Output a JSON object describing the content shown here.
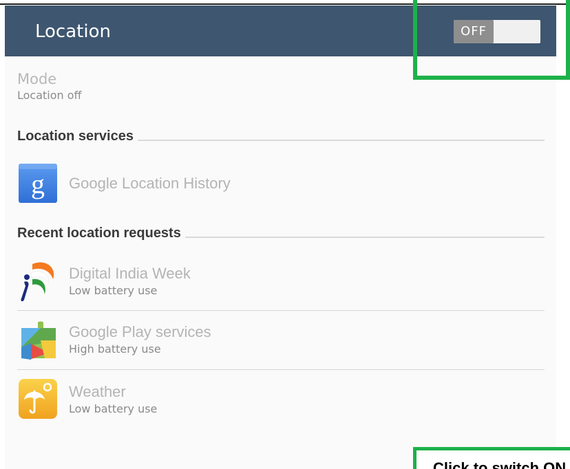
{
  "app_bar": {
    "title": "Location",
    "toggle_label": "OFF",
    "toggle_state": "off"
  },
  "mode": {
    "title": "Mode",
    "summary": "Location off"
  },
  "sections": {
    "location_services": "Location services",
    "recent_requests": "Recent location requests"
  },
  "location_services": [
    {
      "icon": "google-g-icon",
      "title": "Google Location History"
    }
  ],
  "recent_requests": [
    {
      "icon": "digital-india-icon",
      "title": "Digital India Week",
      "subtitle": "Low battery use"
    },
    {
      "icon": "google-play-services-icon",
      "title": "Google Play services",
      "subtitle": "High battery use"
    },
    {
      "icon": "weather-umbrella-icon",
      "title": "Weather",
      "subtitle": "Low battery use"
    }
  ],
  "annotation": {
    "callout_text": "Click to switch ON",
    "highlight_color": "#1db14a"
  },
  "colors": {
    "app_bar": "#3e566f",
    "toggle_off": "#8e8e8e"
  }
}
